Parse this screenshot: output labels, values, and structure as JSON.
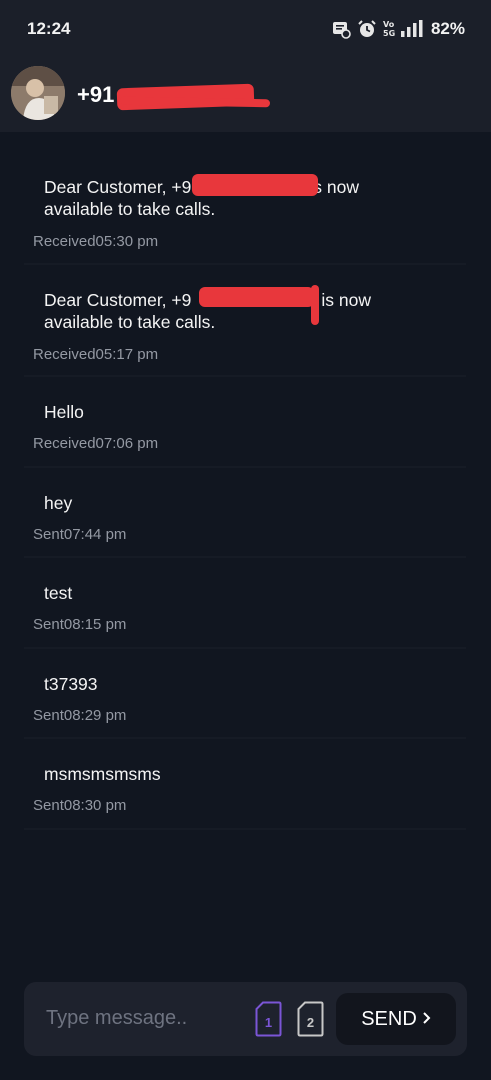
{
  "status_bar": {
    "time": "12:24",
    "battery": "82%",
    "icons": [
      "message-notification-icon",
      "alarm-icon",
      "volte-icon",
      "signal-icon"
    ]
  },
  "header": {
    "number": "+91",
    "avatar_icon": "contact-avatar"
  },
  "messages": [
    {
      "text_before": "Dear Customer, +9",
      "text_after": "is now",
      "line2": "available to take calls.",
      "status": "Received",
      "time": "05:30 pm"
    },
    {
      "text_before": "Dear Customer, +9",
      "text_after": "is now",
      "line2": "available to take calls.",
      "status": "Received",
      "time": "05:17 pm"
    },
    {
      "text": "Hello",
      "status": "Received",
      "time": "07:06 pm"
    },
    {
      "text": "hey",
      "status": "Sent",
      "time": "07:44 pm"
    },
    {
      "text": "test",
      "status": "Sent",
      "time": "08:15 pm"
    },
    {
      "text": "t37393",
      "status": "Sent",
      "time": "08:29 pm"
    },
    {
      "text": "msmsmsmsms",
      "status": "Sent",
      "time": "08:30 pm"
    }
  ],
  "composer": {
    "placeholder": "Type message..",
    "sim1_label": "1",
    "sim2_label": "2",
    "send_label": "SEND",
    "send_icon": "chevron-right-icon",
    "sim1_color": "#7b55d6",
    "sim2_color": "#c8c8c8"
  }
}
